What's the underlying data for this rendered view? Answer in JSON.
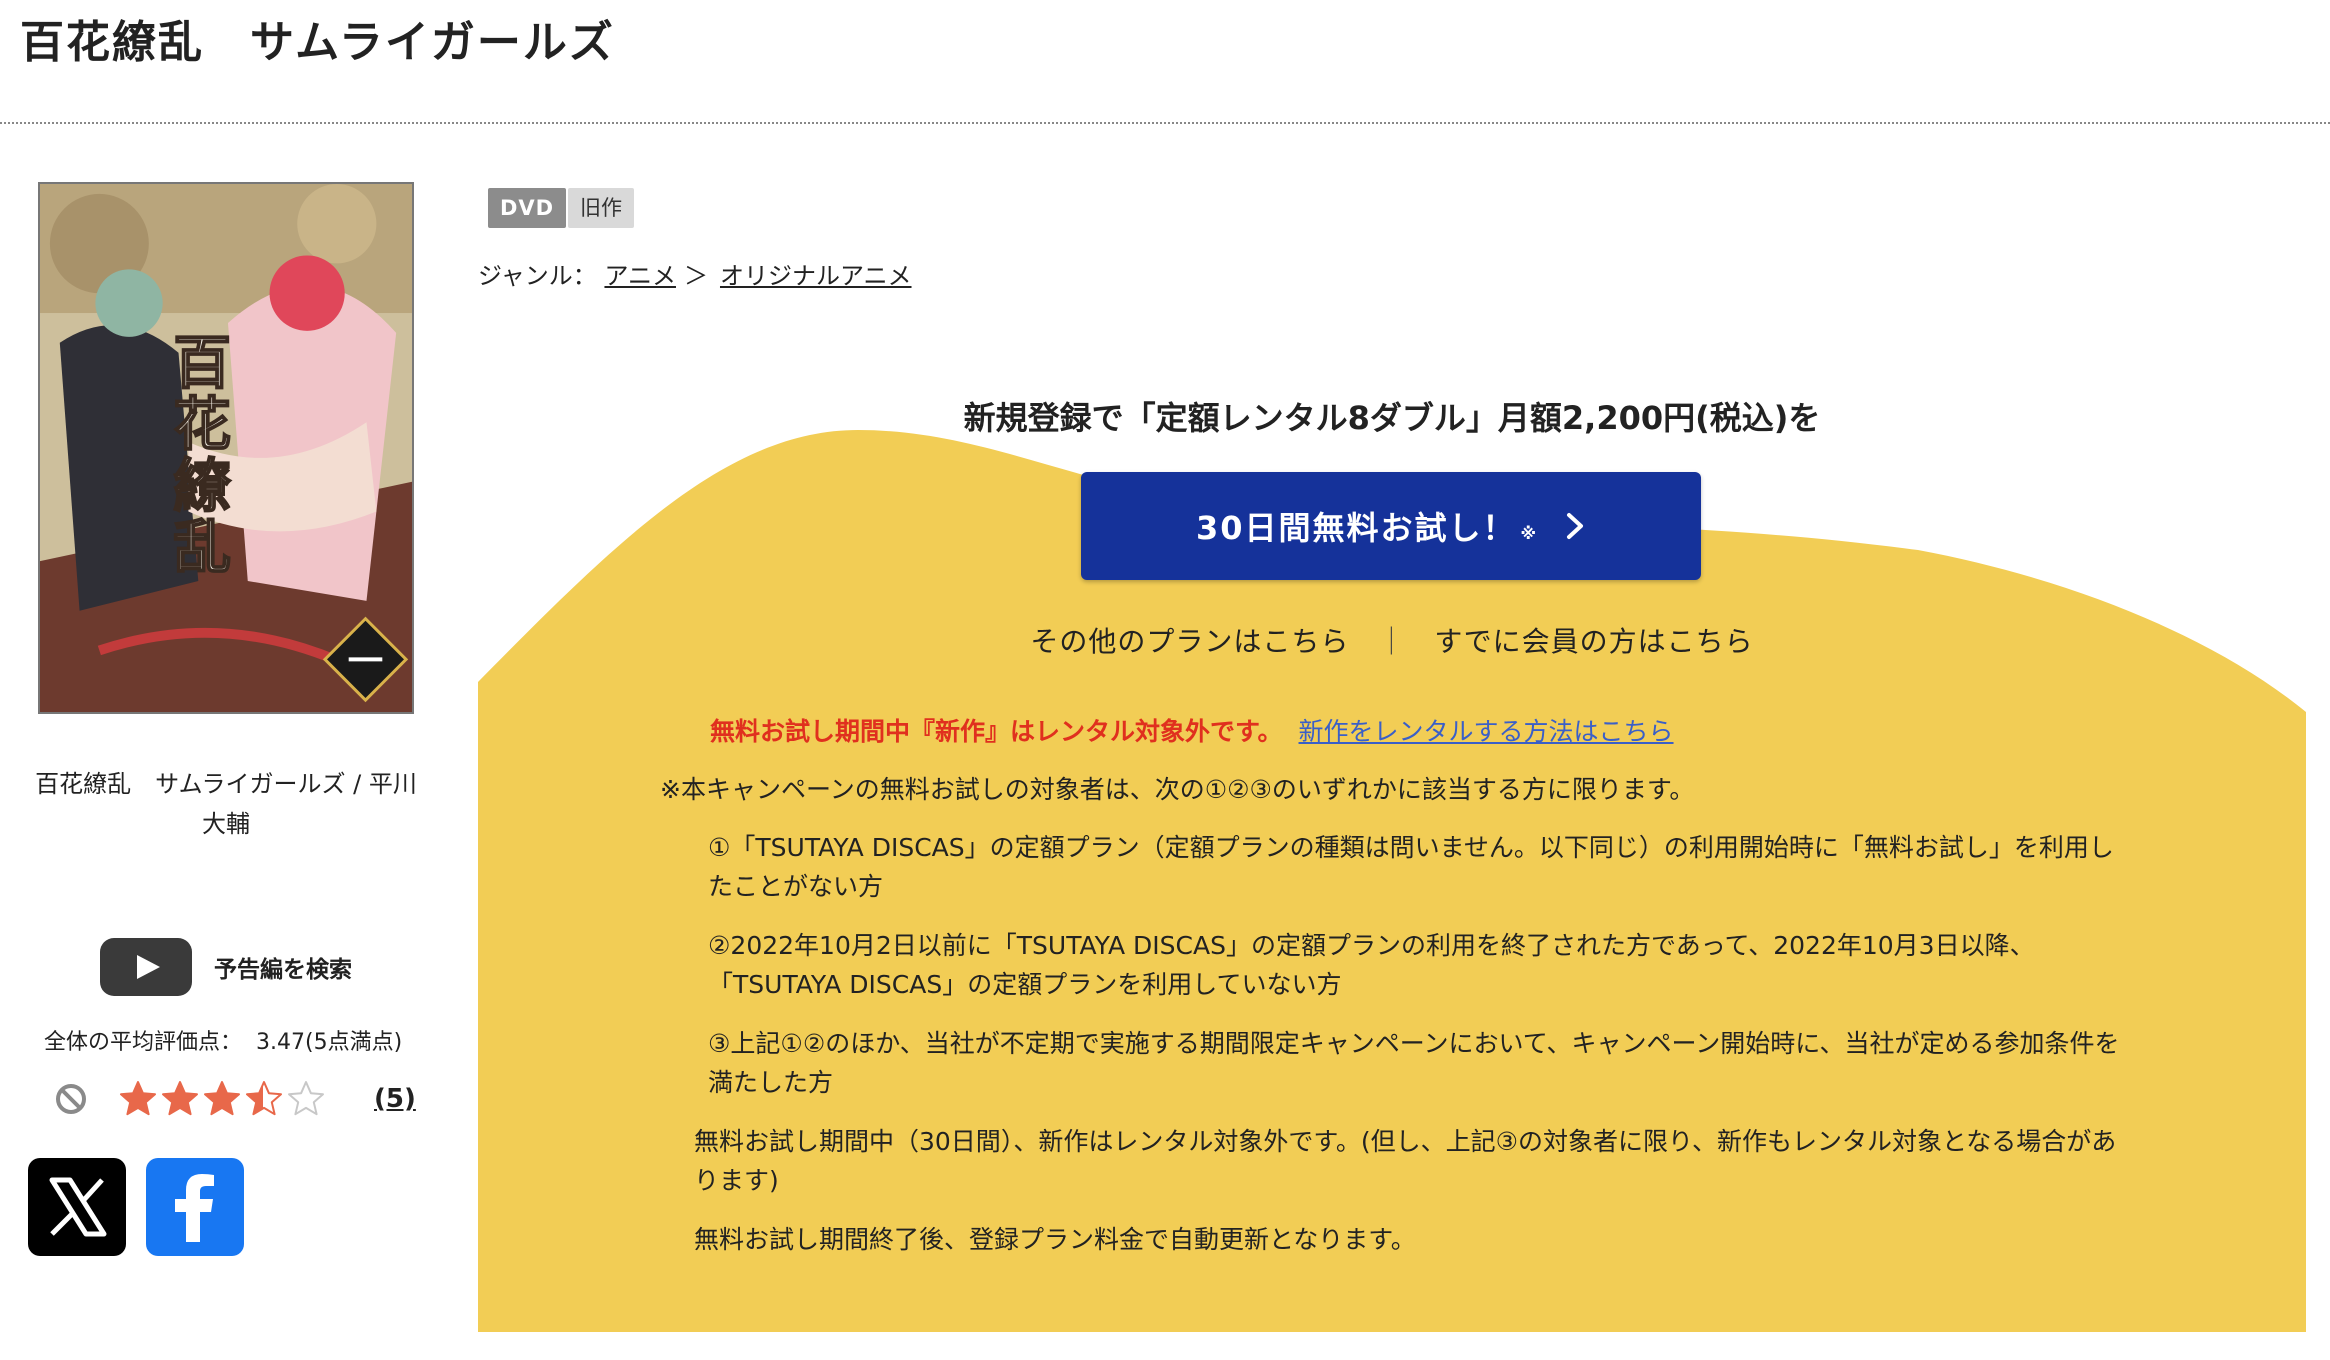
{
  "page": {
    "title": "百花繚乱　サムライガールズ"
  },
  "item": {
    "caption": "百花繚乱　サムライガールズ / 平川大輔",
    "cover_image": "anime-dvd-cover"
  },
  "trailer": {
    "label": "予告編を検索",
    "icon": "youtube-play-icon"
  },
  "rating": {
    "average_label": "全体の平均評価点：",
    "average_value": "3.47(5点満点)",
    "score": 3.47,
    "max": 5,
    "review_count": "(5)",
    "no_rating_icon": "ban-icon",
    "star_color": "#e8684a"
  },
  "share": {
    "x_icon": "x-logo-icon",
    "facebook_icon": "facebook-logo-icon"
  },
  "badges": {
    "format": "DVD",
    "age": "旧作"
  },
  "genre": {
    "label": "ジャンル：",
    "path": [
      "アニメ",
      "オリジナルアニメ"
    ],
    "separator": "＞"
  },
  "promo": {
    "heading": "新規登録で「定額レンタル8ダブル」月額2,200円(税込)を",
    "button_label": "30日間無料お試し！",
    "button_note": "※",
    "button_color": "#15329a",
    "background_color": "#f2cd55",
    "other_plans": "その他のプランはこちら",
    "member_link": "すでに会員の方はこちら",
    "separator": "｜"
  },
  "notice": {
    "red_text": "無料お試し期間中『新作』はレンタル対象外です。",
    "link_text": "新作をレンタルする方法はこちら",
    "campaign_note": "※本キャンペーンの無料お試しの対象者は、次の①②③のいずれかに該当する方に限ります。",
    "conditions": [
      "①「TSUTAYA DISCAS」の定額プラン（定額プランの種類は問いません。以下同じ）の利用開始時に「無料お試し」を利用したことがない方",
      "②2022年10月2日以前に「TSUTAYA DISCAS」の定額プランの利用を終了された方であって、2022年10月3日以降、「TSUTAYA DISCAS」の定額プランを利用していない方",
      "③上記①②のほか、当社が不定期で実施する期間限定キャンペーンにおいて、キャンペーン開始時に、当社が定める参加条件を満たした方"
    ],
    "extra": [
      "無料お試し期間中（30日間）、新作はレンタル対象外です。(但し、上記③の対象者に限り、新作もレンタル対象となる場合があります)",
      "無料お試し期間終了後、登録プラン料金で自動更新となります。"
    ]
  }
}
